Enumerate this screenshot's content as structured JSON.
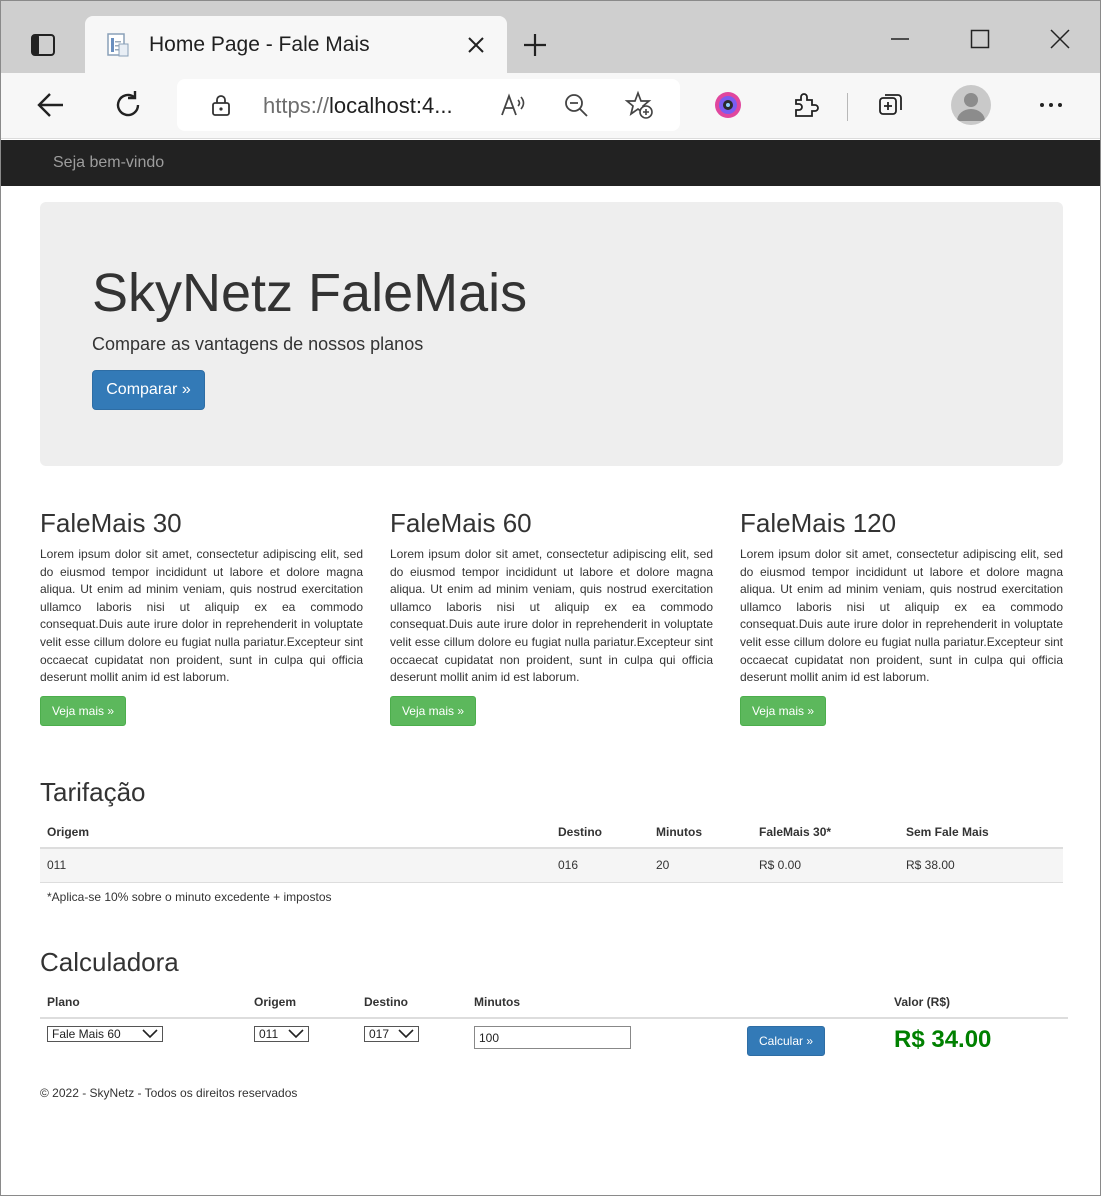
{
  "browser": {
    "tab_title": "Home Page - Fale Mais",
    "url_protocol": "https://",
    "url_host": "localhost:4...",
    "icons": [
      "tab-actions-icon",
      "page-favicon-icon",
      "close-tab-icon",
      "new-tab-icon",
      "minimize-icon",
      "maximize-icon",
      "close-window-icon",
      "back-icon",
      "refresh-icon",
      "lock-icon",
      "read-aloud-icon",
      "zoom-out-icon",
      "add-favorite-icon",
      "extension-color-icon",
      "extensions-icon",
      "collections-icon",
      "profile-icon",
      "more-icon"
    ]
  },
  "navbar": {
    "brand": "Seja bem-vindo"
  },
  "jumbotron": {
    "title": "SkyNetz FaleMais",
    "lead": "Compare as vantagens de nossos planos",
    "button": "Comparar »"
  },
  "plans": [
    {
      "title": "FaleMais 30",
      "text": "Lorem ipsum dolor sit amet, consectetur adipiscing elit, sed do eiusmod tempor incididunt ut labore et dolore magna aliqua. Ut enim ad minim veniam, quis nostrud exercitation ullamco laboris nisi ut aliquip ex ea commodo consequat.Duis aute irure dolor in reprehenderit in voluptate velit esse cillum dolore eu fugiat nulla pariatur.Excepteur sint occaecat cupidatat non proident, sunt in culpa qui officia deserunt mollit anim id est laborum.",
      "button": "Veja mais »"
    },
    {
      "title": "FaleMais 60",
      "text": "Lorem ipsum dolor sit amet, consectetur adipiscing elit, sed do eiusmod tempor incididunt ut labore et dolore magna aliqua. Ut enim ad minim veniam, quis nostrud exercitation ullamco laboris nisi ut aliquip ex ea commodo consequat.Duis aute irure dolor in reprehenderit in voluptate velit esse cillum dolore eu fugiat nulla pariatur.Excepteur sint occaecat cupidatat non proident, sunt in culpa qui officia deserunt mollit anim id est laborum.",
      "button": "Veja mais »"
    },
    {
      "title": "FaleMais 120",
      "text": "Lorem ipsum dolor sit amet, consectetur adipiscing elit, sed do eiusmod tempor incididunt ut labore et dolore magna aliqua. Ut enim ad minim veniam, quis nostrud exercitation ullamco laboris nisi ut aliquip ex ea commodo consequat.Duis aute irure dolor in reprehenderit in voluptate velit esse cillum dolore eu fugiat nulla pariatur.Excepteur sint occaecat cupidatat non proident, sunt in culpa qui officia deserunt mollit anim id est laborum.",
      "button": "Veja mais »"
    }
  ],
  "tarifacao": {
    "title": "Tarifação",
    "headers": [
      "Origem",
      "Destino",
      "Minutos",
      "FaleMais 30*",
      "Sem Fale Mais"
    ],
    "row": [
      "011",
      "016",
      "20",
      "R$ 0.00",
      "R$ 38.00"
    ],
    "note": "*Aplica-se 10% sobre o minuto excedente + impostos"
  },
  "calculadora": {
    "title": "Calculadora",
    "headers": {
      "plano": "Plano",
      "origem": "Origem",
      "destino": "Destino",
      "minutos": "Minutos",
      "valor": "Valor (R$)"
    },
    "plano_selected": "Fale Mais 60",
    "origem_selected": "011",
    "destino_selected": "017",
    "minutos_value": "100",
    "button": "Calcular »",
    "valor": "R$ 34.00"
  },
  "footer": "© 2022 - SkyNetz - Todos os direitos reservados",
  "colors": {
    "navbar": "#222222",
    "primary": "#337ab7",
    "success": "#5cb85c",
    "valor": "#008000",
    "jumbotron": "#eeeeee"
  }
}
